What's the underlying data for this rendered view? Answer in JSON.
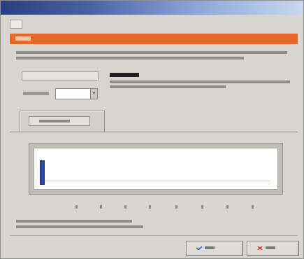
{
  "window": {
    "title": ""
  },
  "menu": {
    "items": [
      {
        "label": ""
      }
    ]
  },
  "orange_header": {
    "label": ""
  },
  "settings": {
    "combo_value": "",
    "combo_arrow": "▾"
  },
  "tabs": [
    {
      "label": ""
    }
  ],
  "track": {
    "handle_position": 0,
    "markers": [
      {
        "label": ""
      },
      {
        "label": ""
      },
      {
        "label": ""
      },
      {
        "label": ""
      },
      {
        "label": ""
      },
      {
        "label": ""
      },
      {
        "label": ""
      },
      {
        "label": ""
      },
      {
        "label": ""
      }
    ]
  },
  "buttons": {
    "ok": {
      "label": ""
    },
    "cancel": {
      "label": ""
    }
  },
  "colors": {
    "header_orange": "#e8682b",
    "title_bar_start": "#2a3f82",
    "title_bar_end": "#c9d7ef",
    "slider_handle": "#2f46a8",
    "ok_icon": "#2f69c8",
    "cancel_icon": "#d8342c"
  },
  "icons": {
    "ok": "blue-check-icon",
    "cancel": "red-x-icon"
  }
}
